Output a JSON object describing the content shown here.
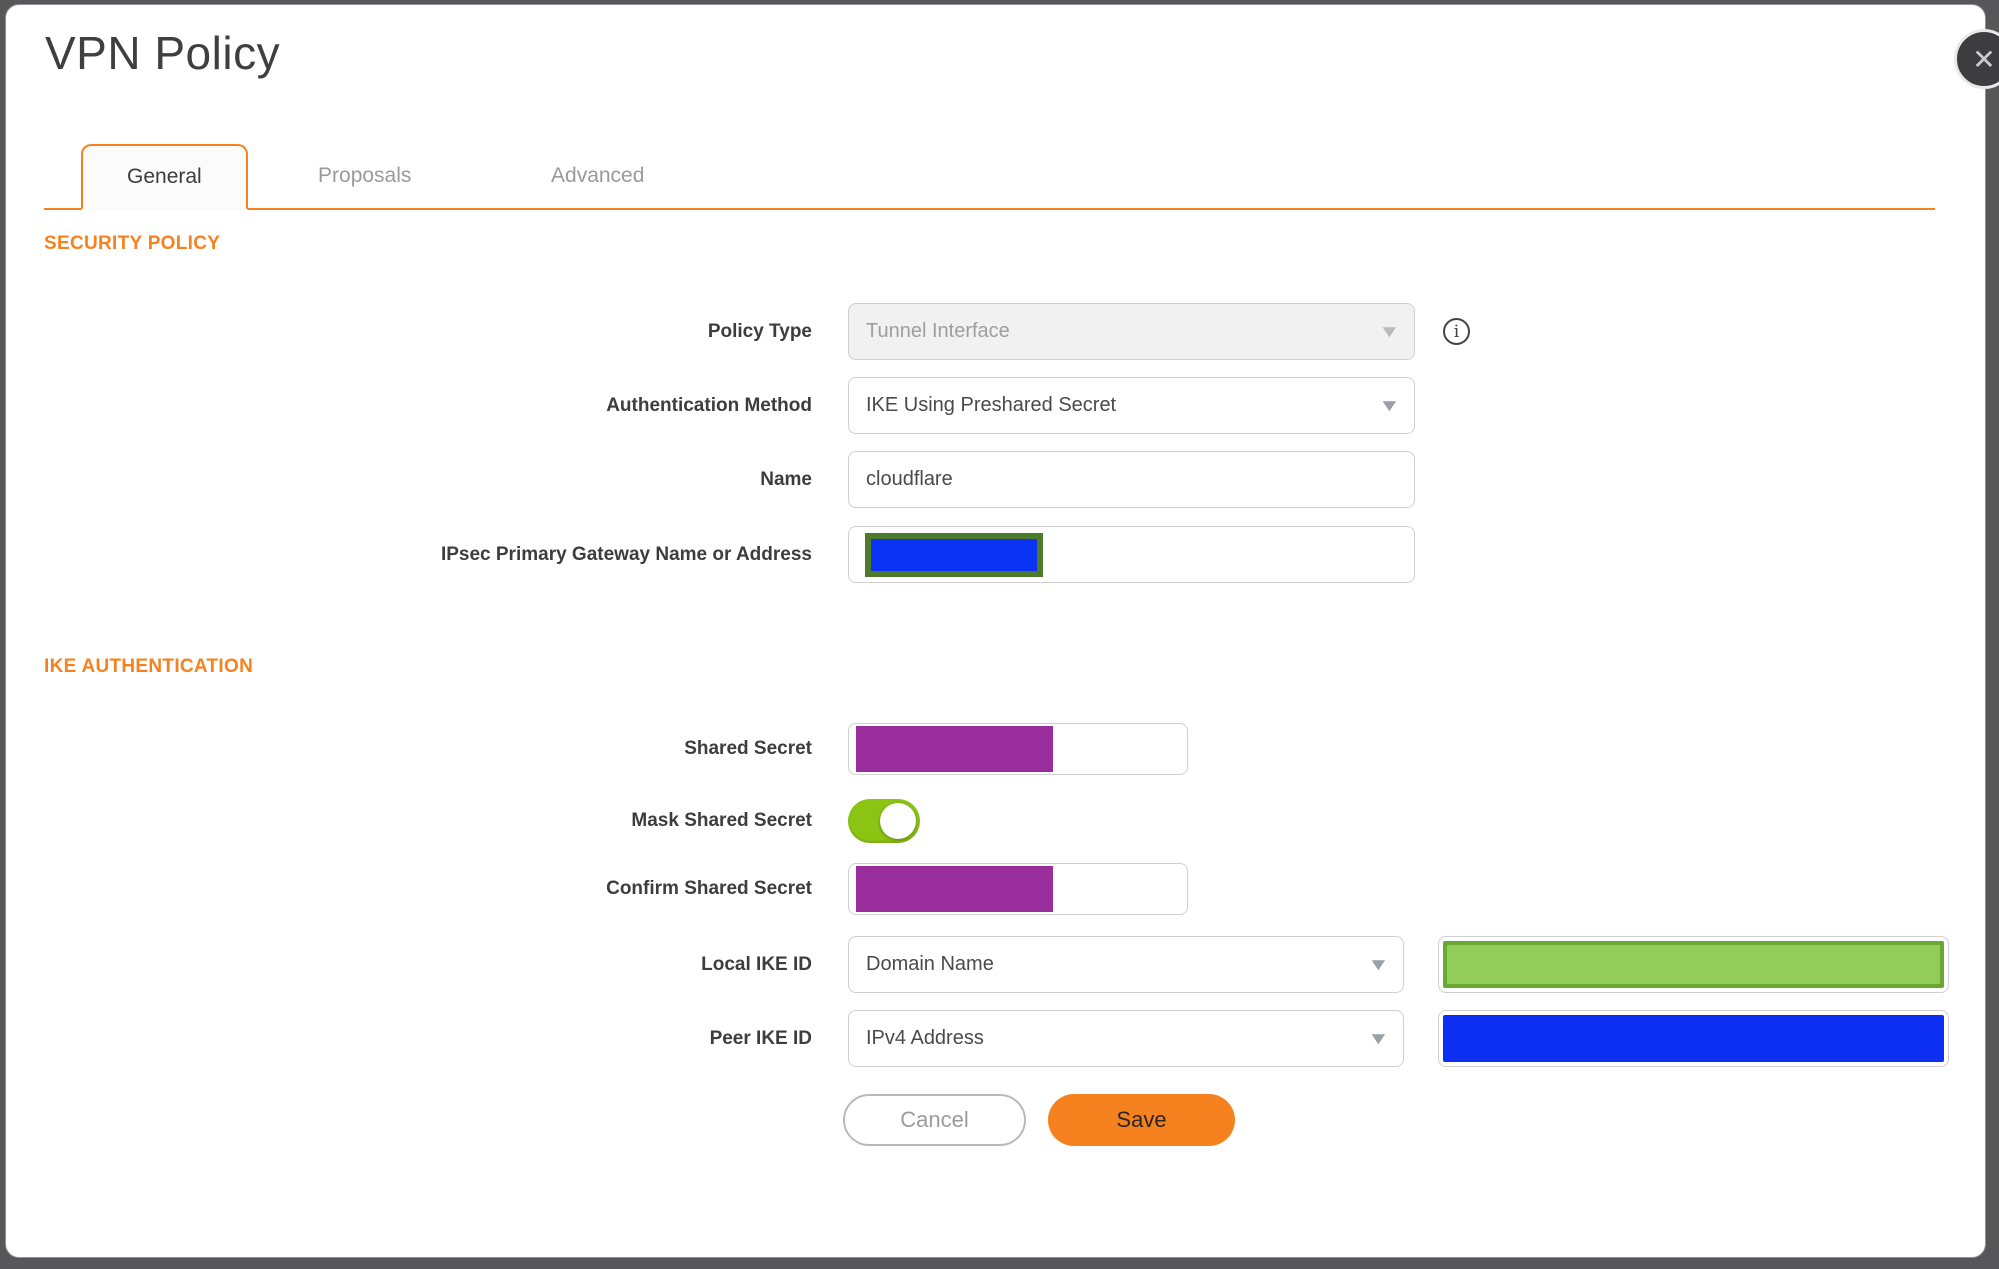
{
  "dialog": {
    "title": "VPN Policy"
  },
  "icons": {
    "close": "✕",
    "dropdown": "▼",
    "info": "i"
  },
  "tabs": [
    {
      "label": "General",
      "active": true
    },
    {
      "label": "Proposals",
      "active": false
    },
    {
      "label": "Advanced",
      "active": false
    }
  ],
  "sections": {
    "security_policy": {
      "heading": "SECURITY POLICY"
    },
    "ike_authentication": {
      "heading": "IKE AUTHENTICATION"
    }
  },
  "fields": {
    "policy_type": {
      "label": "Policy Type",
      "value": "Tunnel Interface",
      "disabled": true
    },
    "authentication_method": {
      "label": "Authentication Method",
      "value": "IKE Using Preshared Secret"
    },
    "name": {
      "label": "Name",
      "value": "cloudflare"
    },
    "ipsec_primary_gateway": {
      "label": "IPsec Primary Gateway Name or Address",
      "value_redacted": true
    },
    "shared_secret": {
      "label": "Shared Secret",
      "value_redacted": true
    },
    "mask_shared_secret": {
      "label": "Mask Shared Secret",
      "state": "on"
    },
    "confirm_shared_secret": {
      "label": "Confirm Shared Secret",
      "value_redacted": true
    },
    "local_ike_id": {
      "label": "Local IKE ID",
      "value": "Domain Name",
      "id_value_redacted": true
    },
    "peer_ike_id": {
      "label": "Peer IKE ID",
      "value": "IPv4 Address",
      "id_value_redacted": true
    }
  },
  "buttons": {
    "cancel": "Cancel",
    "save": "Save"
  },
  "colors": {
    "accent_orange": "#F6821F",
    "toggle_green": "#8CC414",
    "redaction_purple": "#982D9B",
    "redaction_blue": "#0D2FF1",
    "redaction_gateway_blue": "#0B33F3",
    "redaction_gateway_border_olive": "#4E7B2B",
    "redaction_green_fill": "#92CC59",
    "redaction_green_border": "#6AA733",
    "overlay_background": "#57575A"
  }
}
